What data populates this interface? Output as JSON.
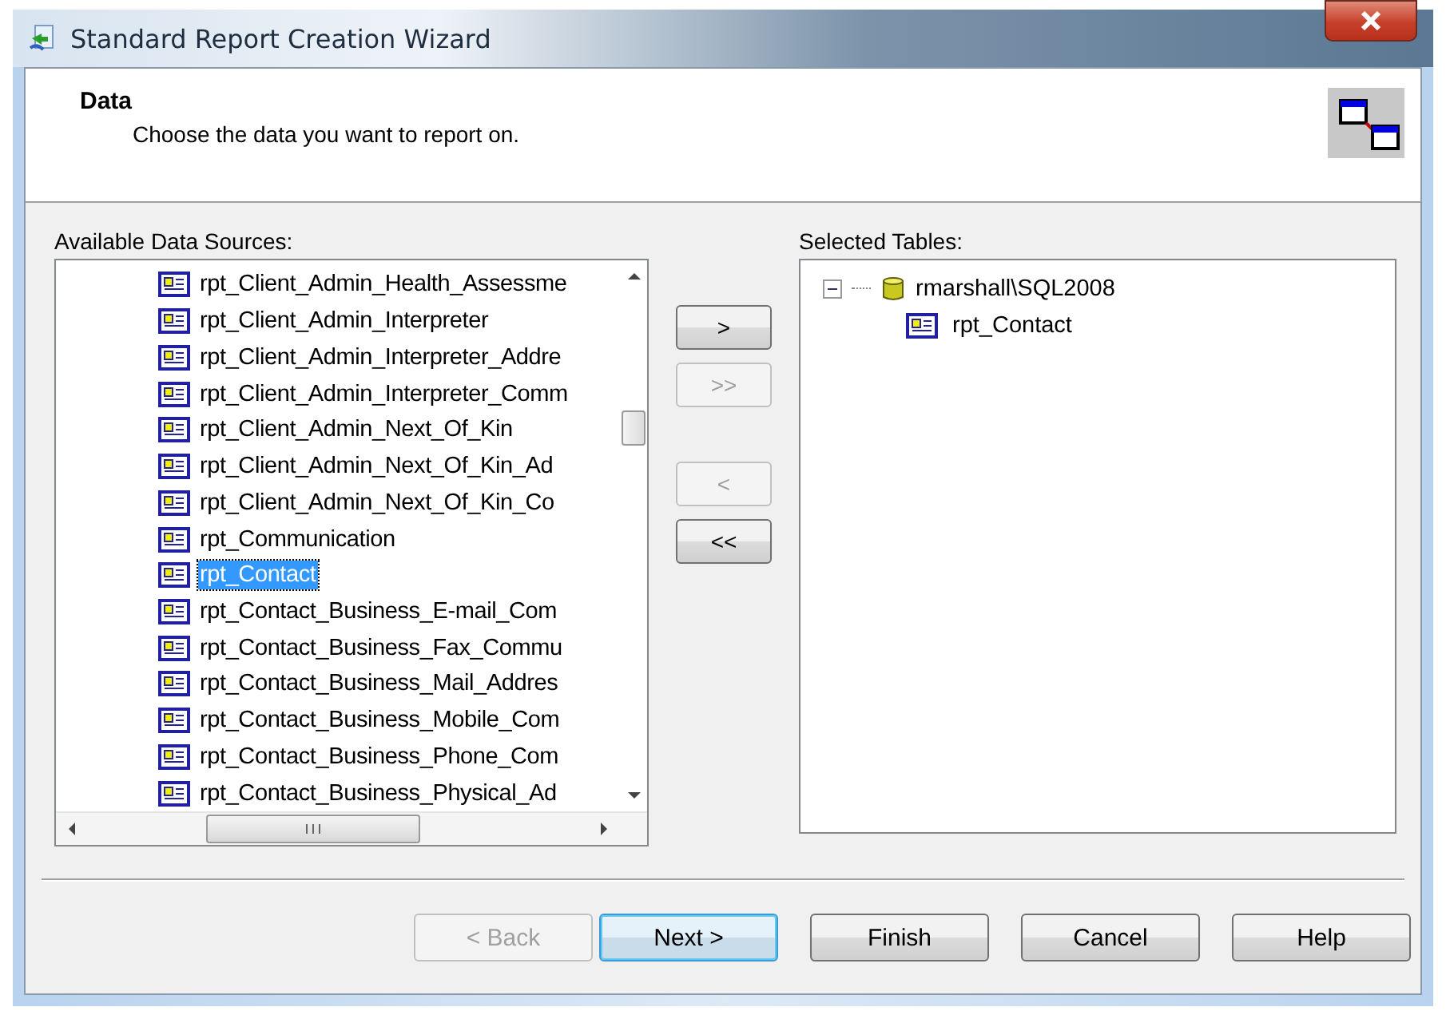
{
  "window": {
    "title": "Standard Report Creation Wizard"
  },
  "header": {
    "title": "Data",
    "subtitle": "Choose the data you want to report on."
  },
  "available": {
    "label": "Available Data Sources:",
    "items": [
      {
        "name": "rpt_Client_Admin_Health_Assessme",
        "selected": false
      },
      {
        "name": "rpt_Client_Admin_Interpreter",
        "selected": false
      },
      {
        "name": "rpt_Client_Admin_Interpreter_Addre",
        "selected": false
      },
      {
        "name": "rpt_Client_Admin_Interpreter_Comm",
        "selected": false
      },
      {
        "name": "rpt_Client_Admin_Next_Of_Kin",
        "selected": false
      },
      {
        "name": "rpt_Client_Admin_Next_Of_Kin_Ad",
        "selected": false
      },
      {
        "name": "rpt_Client_Admin_Next_Of_Kin_Co",
        "selected": false
      },
      {
        "name": "rpt_Communication",
        "selected": false
      },
      {
        "name": "rpt_Contact",
        "selected": true
      },
      {
        "name": "rpt_Contact_Business_E-mail_Com",
        "selected": false
      },
      {
        "name": "rpt_Contact_Business_Fax_Commu",
        "selected": false
      },
      {
        "name": "rpt_Contact_Business_Mail_Addres",
        "selected": false
      },
      {
        "name": "rpt_Contact_Business_Mobile_Com",
        "selected": false
      },
      {
        "name": "rpt_Contact_Business_Phone_Com",
        "selected": false
      },
      {
        "name": "rpt_Contact_Business_Physical_Ad",
        "selected": false
      }
    ]
  },
  "move_buttons": [
    {
      "label": ">",
      "disabled": false
    },
    {
      "label": ">>",
      "disabled": true
    },
    {
      "label": "<",
      "disabled": true
    },
    {
      "label": "<<",
      "disabled": false
    }
  ],
  "selected_tables": {
    "label": "Selected Tables:",
    "tree": [
      {
        "name": "rmarshall\\SQL2008",
        "kind": "server",
        "expanded": true,
        "children": [
          {
            "name": "rpt_Contact",
            "kind": "table"
          }
        ]
      }
    ]
  },
  "buttons": [
    {
      "label": "< Back",
      "disabled": true,
      "default": false
    },
    {
      "label": "Next >",
      "disabled": false,
      "default": true
    },
    {
      "label": "Finish",
      "disabled": false,
      "default": false
    },
    {
      "label": "Cancel",
      "disabled": false,
      "default": false
    },
    {
      "label": "Help",
      "disabled": false,
      "default": false
    }
  ]
}
